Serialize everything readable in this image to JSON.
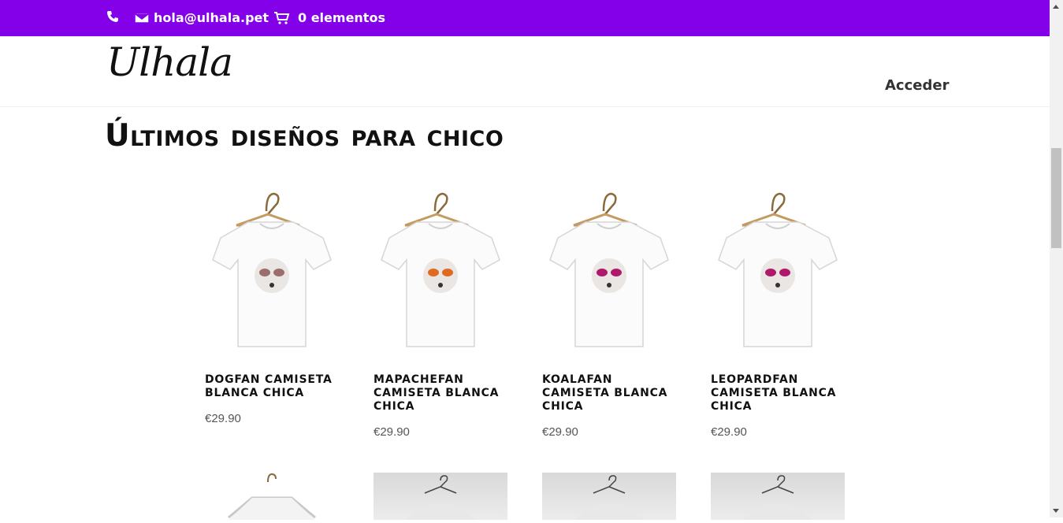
{
  "topbar": {
    "email": "hola@ulhala.pet",
    "cart": "0 elementos",
    "icons": [
      "phone-icon",
      "envelope-icon",
      "cart-icon"
    ]
  },
  "header": {
    "logo": "Ulhala",
    "login": "Acceder"
  },
  "section": {
    "title": "Últimos diseños para chico"
  },
  "products": [
    {
      "name": "DogFan Camiseta Blanca Chica",
      "price": "€29.90",
      "accent": "#9b6e6e"
    },
    {
      "name": "MapacheFan Camiseta Blanca Chica",
      "price": "€29.90",
      "accent": "#e06a1f"
    },
    {
      "name": "KoalaFan Camiseta Blanca Chica",
      "price": "€29.90",
      "accent": "#b0186b"
    },
    {
      "name": "LeopardFan Camiseta Blanca Chica",
      "price": "€29.90",
      "accent": "#b0186b"
    }
  ],
  "colors": {
    "topbar": "#8300e9"
  }
}
